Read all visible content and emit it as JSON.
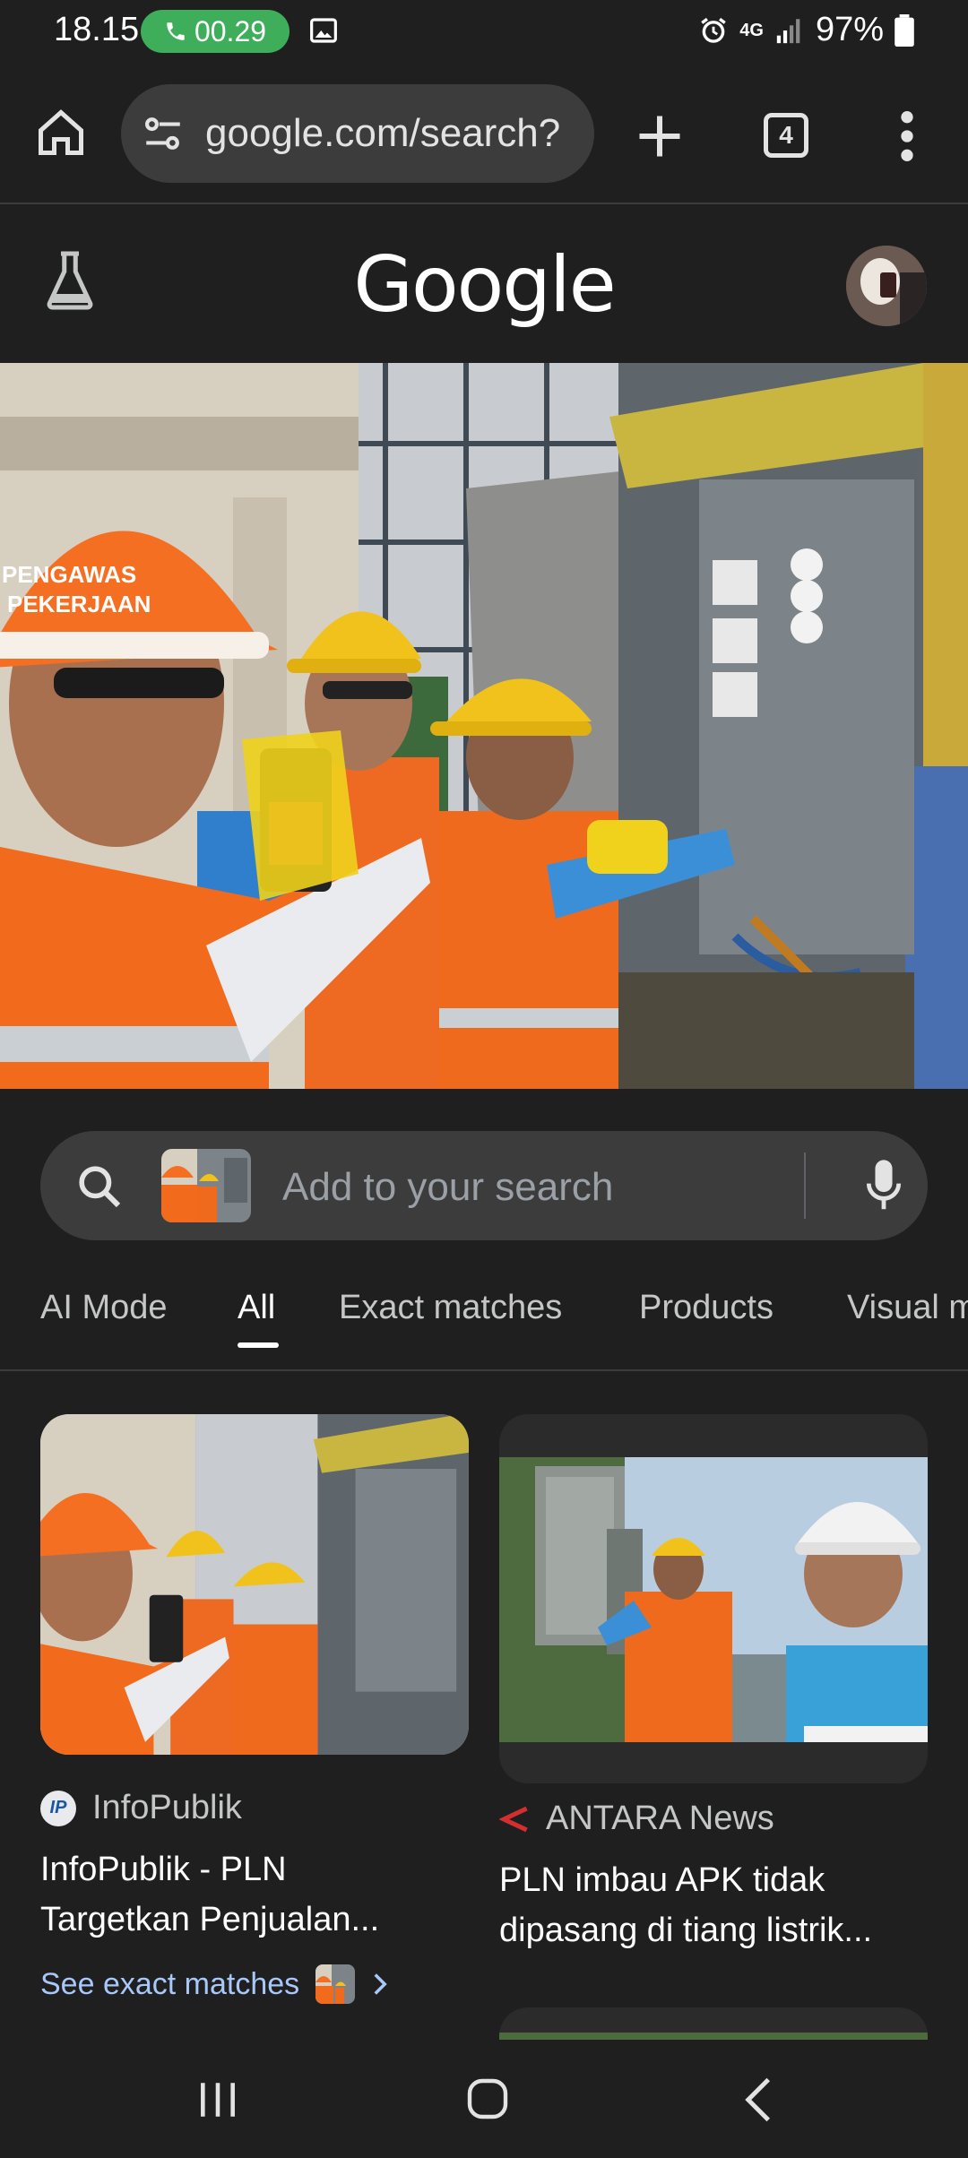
{
  "status_bar": {
    "time": "18.15",
    "call_timer": "00.29",
    "network": "4G",
    "battery": "97%"
  },
  "toolbar": {
    "url": "google.com/search?",
    "tab_count": "4"
  },
  "google": {
    "logo": "Google"
  },
  "hero": {
    "helmet_text_line1": "PENGAWAS",
    "helmet_text_line2": "PEKERJAAN"
  },
  "search_bar": {
    "placeholder": "Add to your search"
  },
  "tabs": [
    {
      "label": "AI Mode",
      "active": false
    },
    {
      "label": "All",
      "active": true
    },
    {
      "label": "Exact matches",
      "active": false
    },
    {
      "label": "Products",
      "active": false
    },
    {
      "label": "Visual m",
      "active": false
    }
  ],
  "results": [
    {
      "source": "InfoPublik",
      "logo": "IP",
      "title_line1": "InfoPublik - PLN",
      "title_line2": "Targetkan Penjualan...",
      "see_exact": "See exact matches"
    },
    {
      "source": "ANTARA News",
      "title_line1": "PLN imbau APK tidak",
      "title_line2": "dipasang di tiang listrik..."
    }
  ],
  "colors": {
    "background": "#1f1f1f",
    "surface": "#3c3c3c",
    "call_green": "#3fae5a",
    "link_blue": "#a8c7fa",
    "antara_red": "#d32f2f"
  }
}
